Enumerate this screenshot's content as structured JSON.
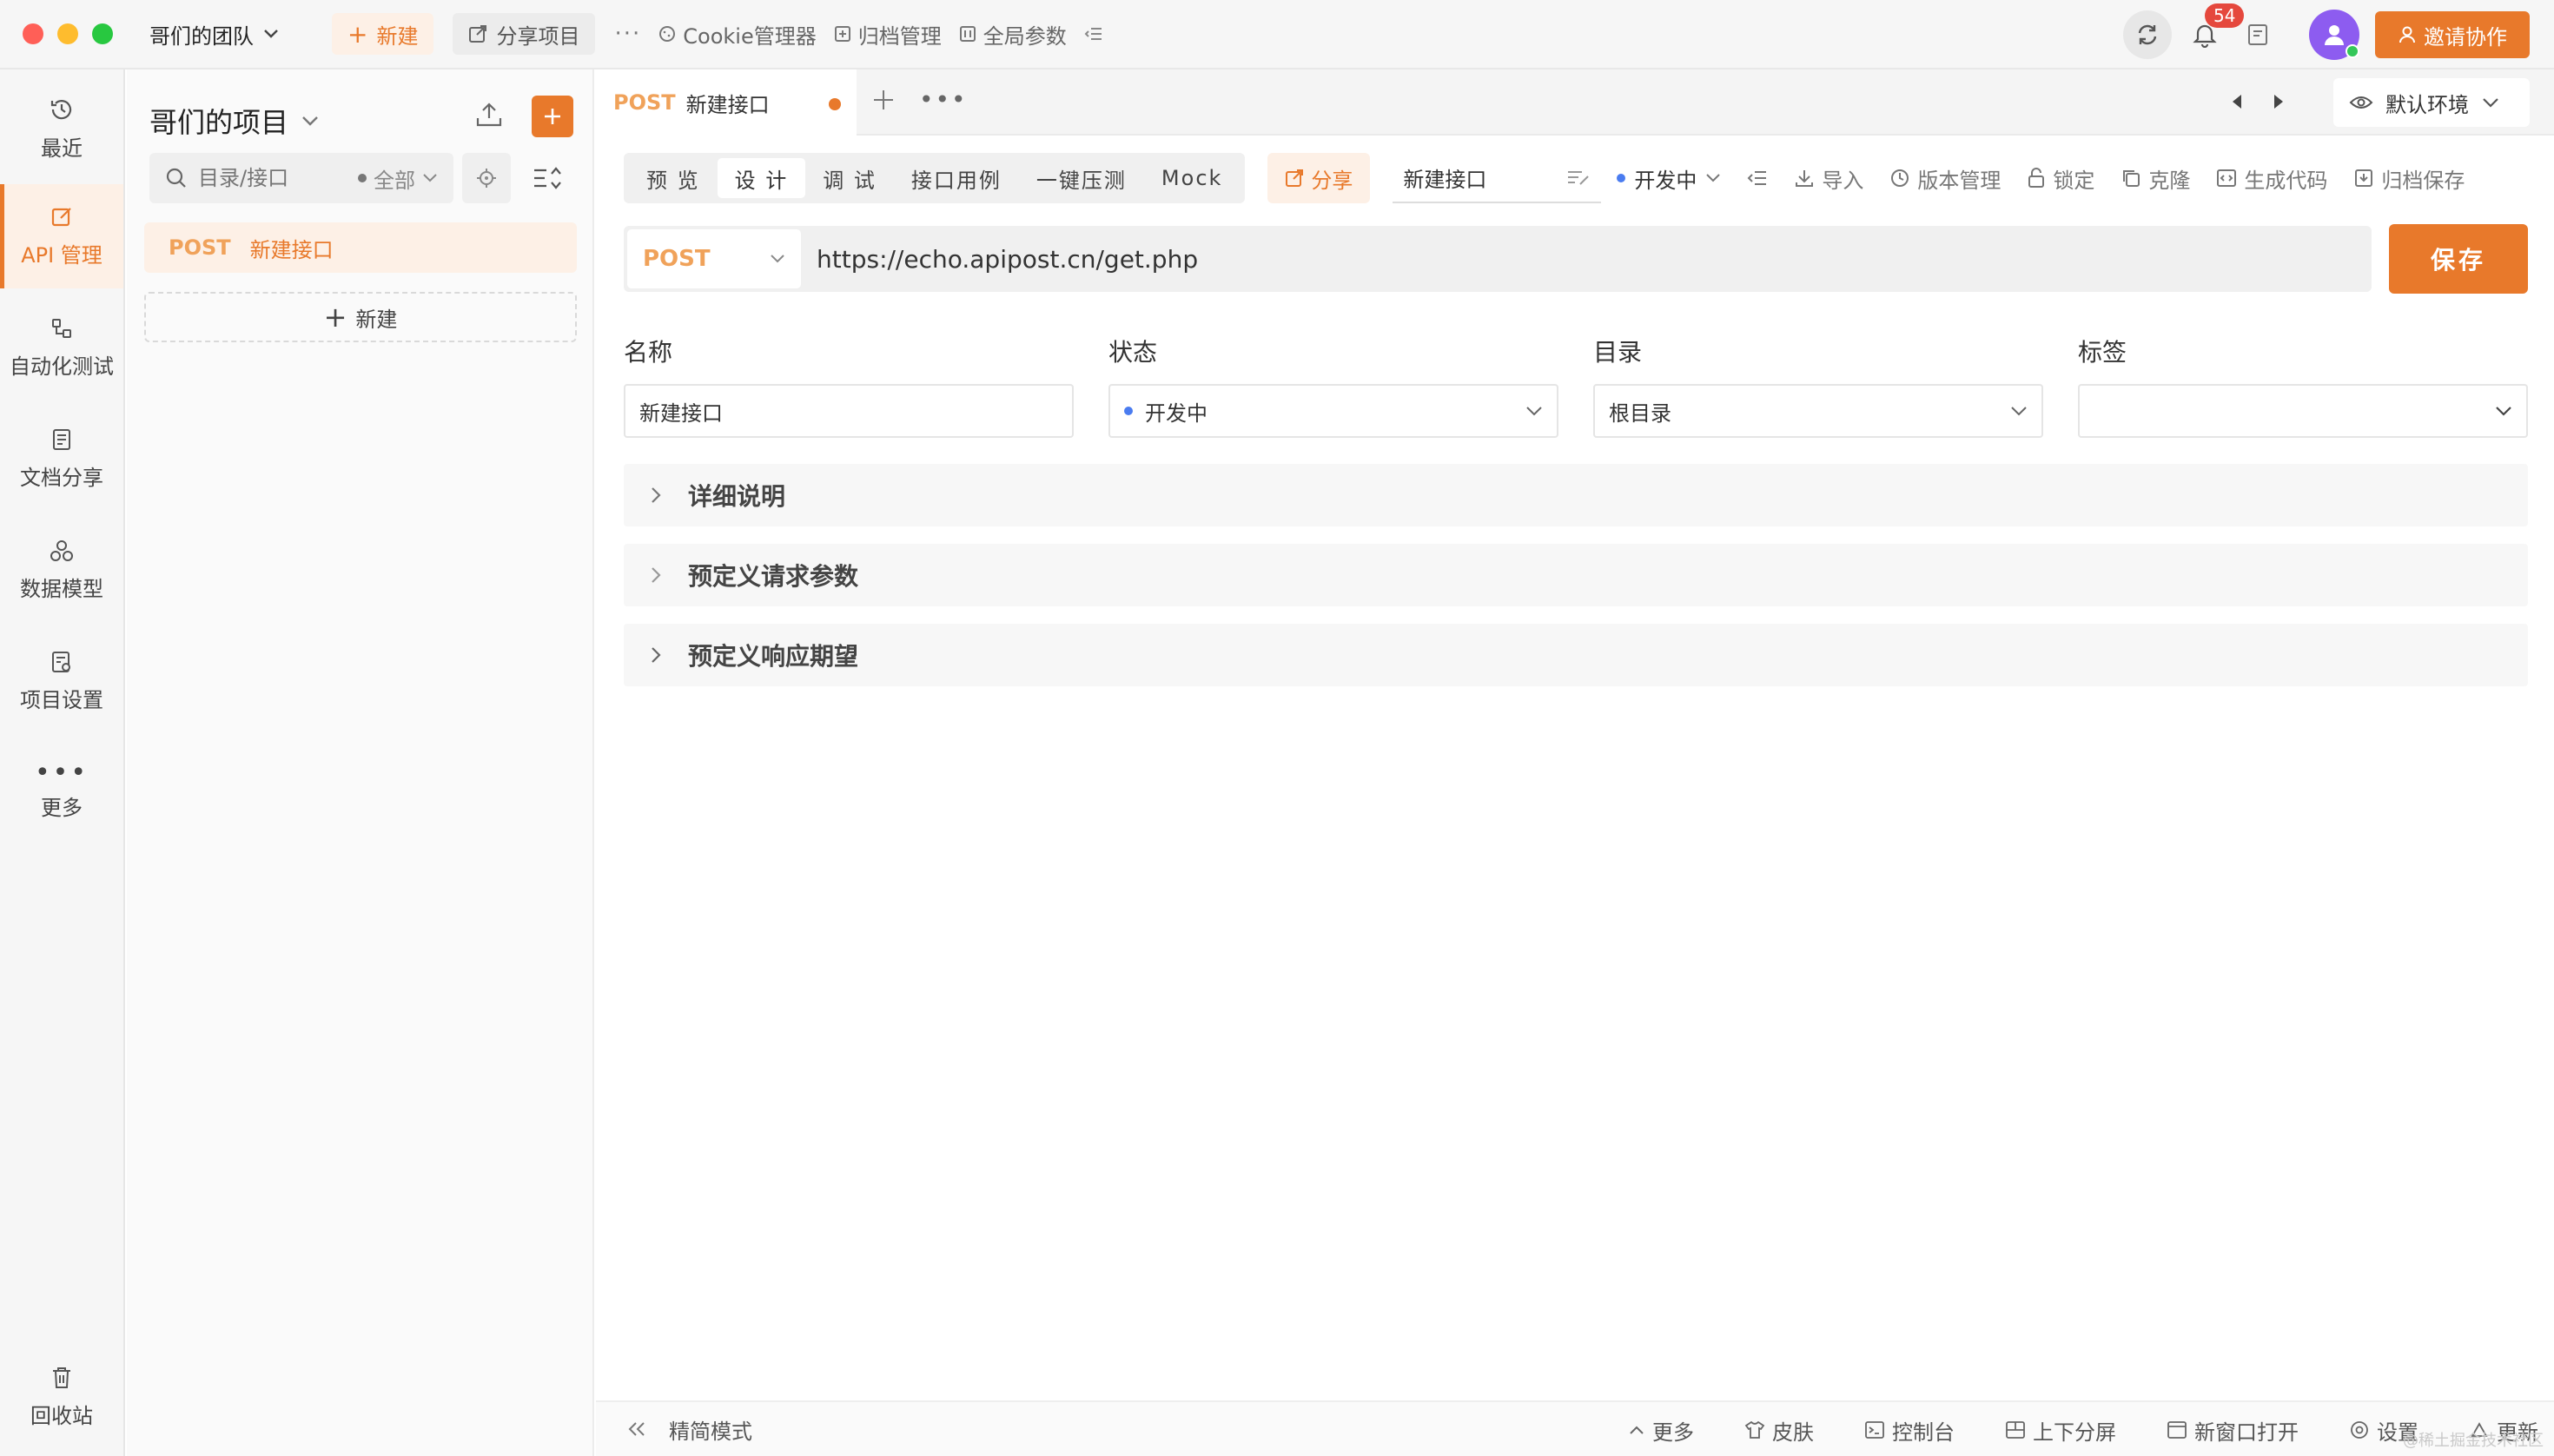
{
  "titlebar": {
    "team": "哥们的团队",
    "new_label": "新建",
    "share_project": "分享项目",
    "more": "···",
    "cookie_manager": "Cookie管理器",
    "archive_manager": "归档管理",
    "global_params": "全局参数",
    "notification_count": "54",
    "invite": "邀请协作"
  },
  "leftnav": {
    "items": [
      {
        "label": "最近",
        "icon": "history-icon"
      },
      {
        "label": "API 管理",
        "icon": "edit-icon"
      },
      {
        "label": "自动化测试",
        "icon": "flow-icon"
      },
      {
        "label": "文档分享",
        "icon": "document-icon"
      },
      {
        "label": "数据模型",
        "icon": "model-icon"
      },
      {
        "label": "项目设置",
        "icon": "settings-doc-icon"
      },
      {
        "label": "更多",
        "icon": "more-icon"
      }
    ],
    "trash": "回收站",
    "active_color": "#e8792b"
  },
  "panel": {
    "project_title": "哥们的项目",
    "search_placeholder": "目录/接口",
    "filter": "全部",
    "api_item": {
      "method": "POST",
      "name": "新建接口"
    },
    "add_new": "新建"
  },
  "tabs": {
    "active": {
      "method": "POST",
      "name": "新建接口"
    },
    "environment": "默认环境"
  },
  "toolbar": {
    "modes": [
      "预 览",
      "设 计",
      "调 试",
      "接口用例",
      "一键压测",
      "Mock"
    ],
    "active_mode": 1,
    "share": "分享",
    "name_value": "新建接口",
    "status": "开发中",
    "import": "导入",
    "version": "版本管理",
    "lock": "锁定",
    "clone": "克隆",
    "gen_code": "生成代码",
    "archive_save": "归档保存"
  },
  "request": {
    "method": "POST",
    "url": "https://echo.apipost.cn/get.php",
    "save": "保存"
  },
  "fields": {
    "name_label": "名称",
    "name_value": "新建接口",
    "status_label": "状态",
    "status_value": "开发中",
    "dir_label": "目录",
    "dir_value": "根目录",
    "tag_label": "标签",
    "tag_value": ""
  },
  "sections": [
    "详细说明",
    "预定义请求参数",
    "预定义响应期望"
  ],
  "statusbar": {
    "compact": "精简模式",
    "more": "更多",
    "skin": "皮肤",
    "console": "控制台",
    "split": "上下分屏",
    "new_window": "新窗口打开",
    "settings": "设置",
    "update": "更新"
  },
  "watermark": "@稀土掘金技术社区",
  "colors": {
    "accent": "#e8792b",
    "accent_bg": "#fdf0e6",
    "status_dot": "#4a7cf0"
  }
}
